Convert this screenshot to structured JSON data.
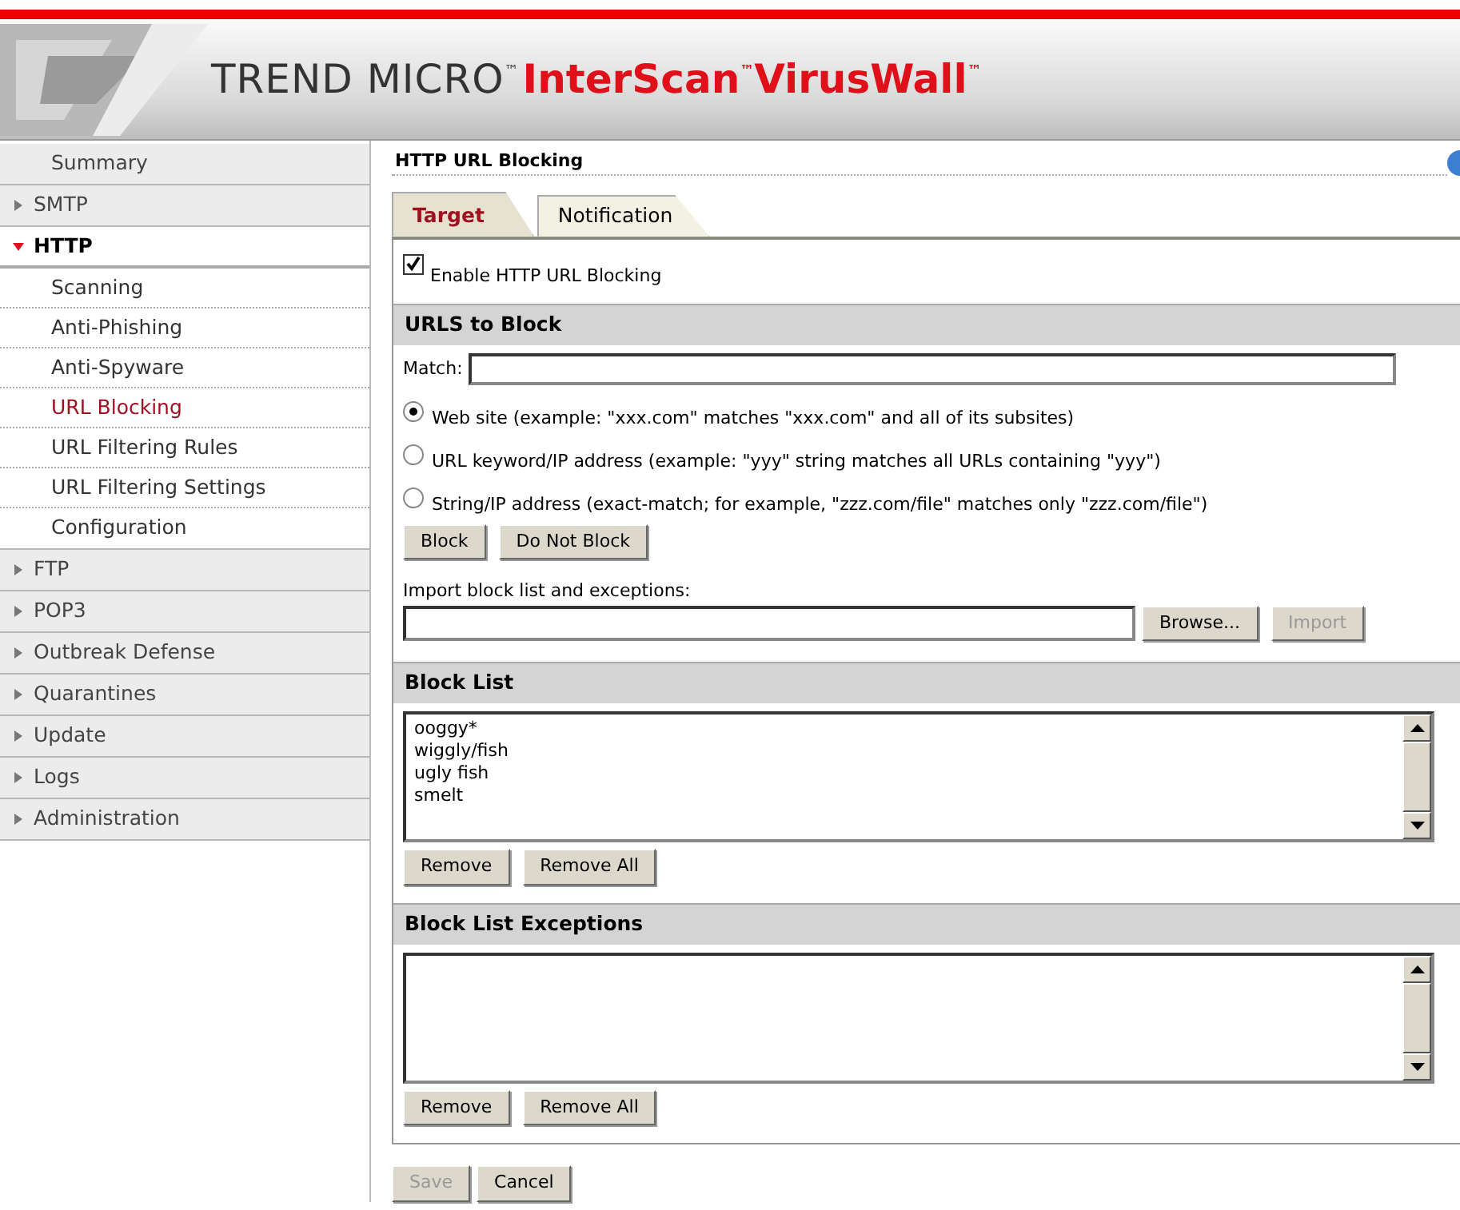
{
  "header": {
    "vendor": "TREND MICRO$^{™}$",
    "product": "InterScan$^{™}$VirusWall$^{™}$"
  },
  "sidebar": {
    "items": [
      {
        "kind": "link",
        "label": "Summary"
      },
      {
        "kind": "group",
        "label": "SMTP",
        "expanded": false
      },
      {
        "kind": "group",
        "label": "HTTP",
        "expanded": true,
        "children": [
          {
            "label": "Scanning",
            "selected": false
          },
          {
            "label": "Anti-Phishing",
            "selected": false
          },
          {
            "label": "Anti-Spyware",
            "selected": false
          },
          {
            "label": "URL Blocking",
            "selected": true
          },
          {
            "label": "URL Filtering Rules",
            "selected": false
          },
          {
            "label": "URL Filtering Settings",
            "selected": false
          },
          {
            "label": "Configuration",
            "selected": false
          }
        ]
      },
      {
        "kind": "group",
        "label": "FTP",
        "expanded": false
      },
      {
        "kind": "group",
        "label": "POP3",
        "expanded": false
      },
      {
        "kind": "group",
        "label": "Outbreak Defense",
        "expanded": false
      },
      {
        "kind": "group",
        "label": "Quarantines",
        "expanded": false
      },
      {
        "kind": "group",
        "label": "Update",
        "expanded": false
      },
      {
        "kind": "group",
        "label": "Logs",
        "expanded": false
      },
      {
        "kind": "group",
        "label": "Administration",
        "expanded": false
      }
    ]
  },
  "page": {
    "title": "HTTP URL Blocking",
    "tabs": [
      {
        "label": "Target",
        "selected": true
      },
      {
        "label": "Notification",
        "selected": false
      }
    ],
    "enable": {
      "label": "Enable HTTP URL Blocking",
      "checked": true
    },
    "urls_section": {
      "title": "URLS to Block",
      "match_label": "Match:",
      "options": [
        {
          "label": "Web site (example: \"xxx.com\" matches \"xxx.com\" and all of its subsites)",
          "selected": true
        },
        {
          "label": "URL keyword/IP address (example: \"yyy\" string matches all URLs containing \"yyy\")",
          "selected": false
        },
        {
          "label": "String/IP address (exact-match; for example, \"zzz.com/file\" matches only \"zzz.com/file\")",
          "selected": false
        }
      ],
      "buttons": [
        {
          "label": "Block",
          "disabled": false
        },
        {
          "label": "Do Not Block",
          "disabled": false
        }
      ],
      "import_label": "Import block list and exceptions:",
      "import_buttons": [
        {
          "label": "Browse...",
          "disabled": false
        },
        {
          "label": "Import",
          "disabled": true
        }
      ]
    },
    "lists": [
      {
        "title": "Block List",
        "items": [
          "ooggy*",
          "wiggly/fish",
          "ugly fish",
          "smelt"
        ],
        "buttons": [
          {
            "label": "Remove",
            "disabled": false
          },
          {
            "label": "Remove All",
            "disabled": false
          }
        ]
      },
      {
        "title": "Block List Exceptions",
        "buttons": [
          {
            "label": "Remove",
            "disabled": false
          },
          {
            "label": "Remove All",
            "disabled": false
          }
        ]
      }
    ],
    "footer_buttons": [
      {
        "label": "Save",
        "disabled": true
      },
      {
        "label": "Cancel",
        "disabled": false
      }
    ]
  }
}
